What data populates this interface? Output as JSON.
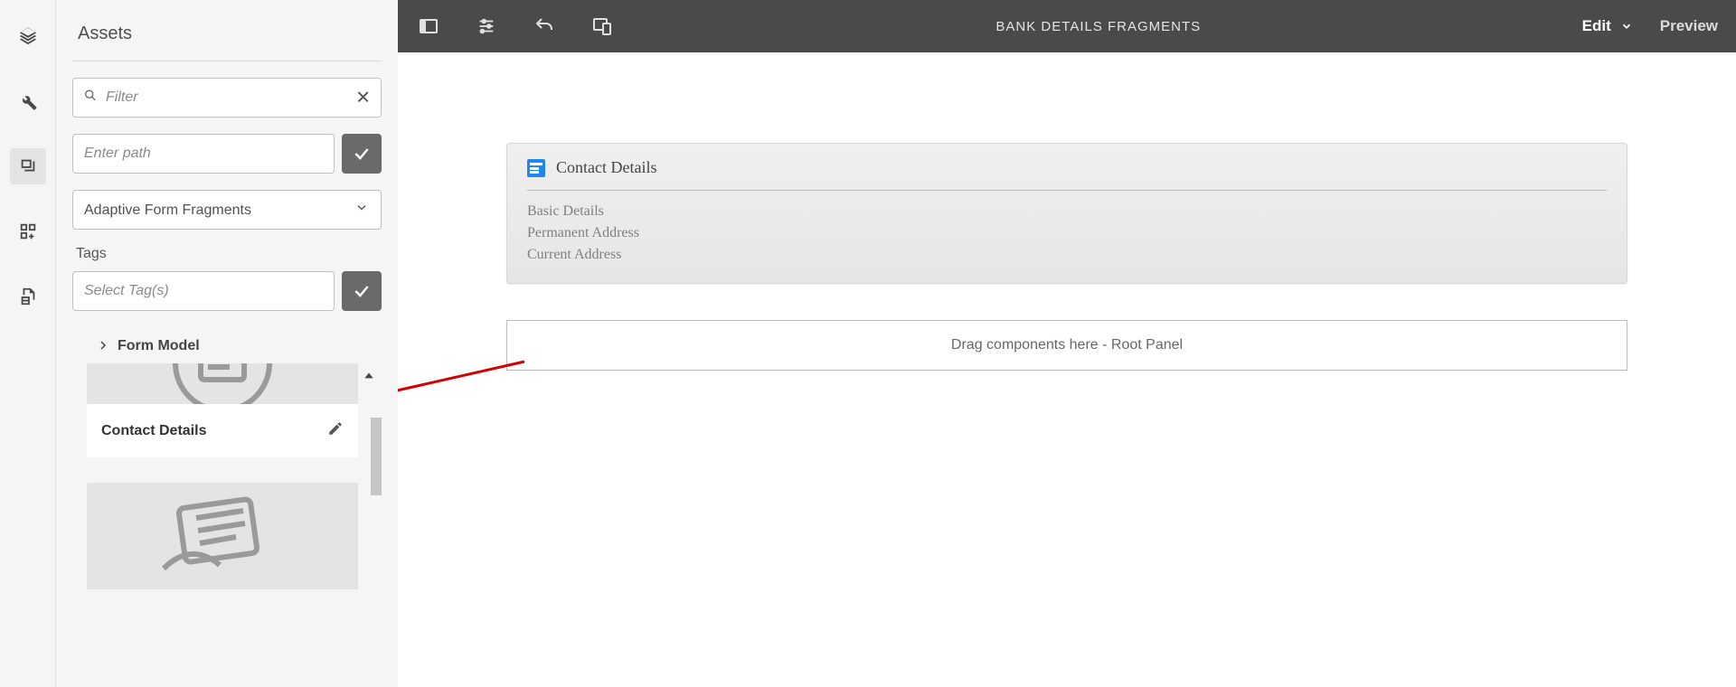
{
  "panel": {
    "title": "Assets",
    "filter_placeholder": "Filter",
    "path_placeholder": "Enter path",
    "fragment_type": "Adaptive Form Fragments",
    "tags_label": "Tags",
    "tags_placeholder": "Select Tag(s)",
    "form_model_label": "Form Model",
    "asset_item_title": "Contact Details"
  },
  "topbar": {
    "title": "BANK DETAILS FRAGMENTS",
    "edit_label": "Edit",
    "preview_label": "Preview"
  },
  "canvas": {
    "contact_title": "Contact Details",
    "tabs": {
      "basic": "Basic Details",
      "permanent": "Permanent Address",
      "current": "Current Address"
    },
    "dropzone_text": "Drag components here - Root Panel"
  }
}
